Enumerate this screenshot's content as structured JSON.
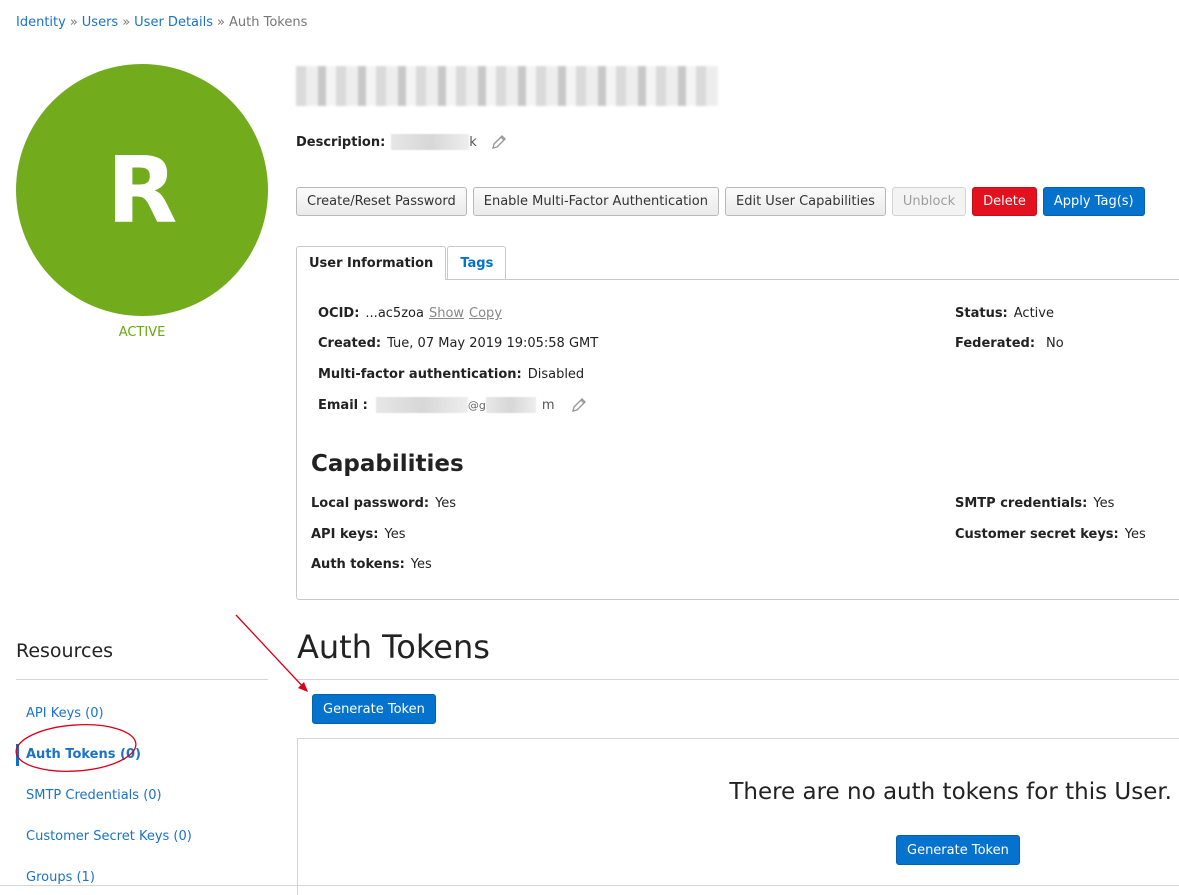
{
  "breadcrumb": {
    "items": [
      "Identity",
      "Users",
      "User Details"
    ],
    "separator": "»",
    "current": "Auth Tokens"
  },
  "user": {
    "avatar_letter": "R",
    "status": "ACTIVE",
    "description_label": "Description:",
    "description_visible_tail": "k"
  },
  "actions": {
    "create_reset_password": "Create/Reset Password",
    "enable_mfa": "Enable Multi-Factor Authentication",
    "edit_capabilities": "Edit User Capabilities",
    "unblock": "Unblock",
    "delete": "Delete",
    "apply_tags": "Apply Tag(s)"
  },
  "tabs": {
    "user_info": "User Information",
    "tags": "Tags"
  },
  "info": {
    "ocid_label": "OCID:",
    "ocid_value": "...ac5zoa",
    "ocid_show": "Show",
    "ocid_copy": "Copy",
    "created_label": "Created:",
    "created_value": "Tue, 07 May 2019 19:05:58 GMT",
    "mfa_label": "Multi-factor authentication:",
    "mfa_value": "Disabled",
    "email_label": "Email :",
    "email_visible_part": "@g",
    "email_visible_tail": "m",
    "status_label": "Status:",
    "status_value": "Active",
    "federated_label": "Federated:",
    "federated_value": "No"
  },
  "capabilities": {
    "title": "Capabilities",
    "local_password_label": "Local password:",
    "local_password_value": "Yes",
    "api_keys_label": "API keys:",
    "api_keys_value": "Yes",
    "auth_tokens_label": "Auth tokens:",
    "auth_tokens_value": "Yes",
    "smtp_label": "SMTP credentials:",
    "smtp_value": "Yes",
    "customer_secret_label": "Customer secret keys:",
    "customer_secret_value": "Yes"
  },
  "resources": {
    "title": "Resources",
    "items": [
      "API Keys (0)",
      "Auth Tokens (0)",
      "SMTP Credentials (0)",
      "Customer Secret Keys (0)",
      "Groups (1)"
    ]
  },
  "auth_tokens": {
    "title": "Auth Tokens",
    "generate_button": "Generate Token",
    "empty_message": "There are no auth tokens for this User.",
    "empty_generate_button": "Generate Token"
  },
  "colors": {
    "avatar": "#72ac1c",
    "link": "#1a73c7",
    "primary": "#0572ce",
    "danger": "#e3101e",
    "annotation": "#d9001b"
  }
}
